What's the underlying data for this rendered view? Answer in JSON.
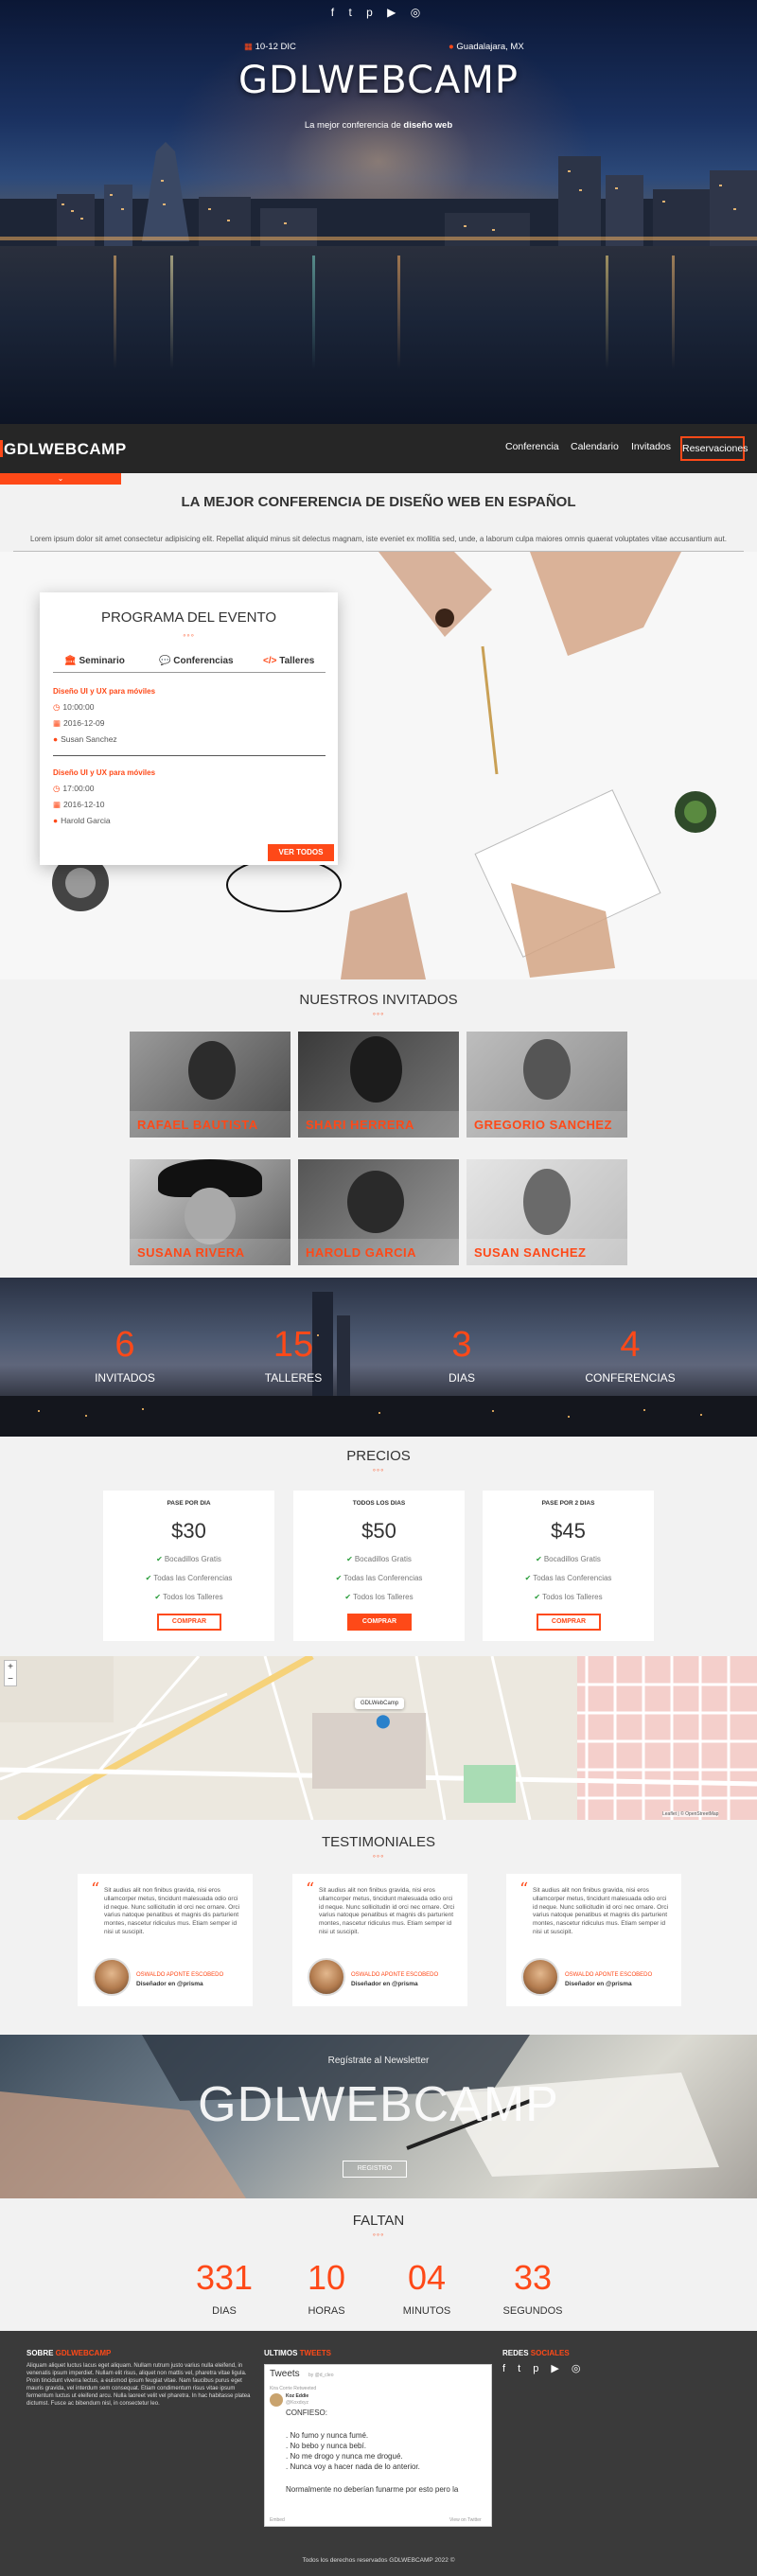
{
  "hero": {
    "social_icons": [
      "facebook-icon",
      "twitter-icon",
      "pinterest-icon",
      "youtube-icon",
      "instagram-icon"
    ],
    "social_glyphs": "f  t  p  ▶  ◎",
    "date_icon": "calendar-icon",
    "date": "10-12 DIC",
    "location_icon": "map-marker-icon",
    "location": "Guadalajara, MX",
    "logo": "GDLWEBCAMP",
    "tagline_pre": "La mejor conferencia de ",
    "tagline_bold": "diseño web"
  },
  "nav": {
    "brand": "GDLWEBCAMP",
    "items": [
      "Conferencia",
      "Calendario",
      "Invitados"
    ],
    "cta": "Reservaciones",
    "chevron": "⌄"
  },
  "intro": {
    "title": "LA MEJOR CONFERENCIA DE DISEÑO WEB EN ESPAÑOL",
    "text": "Lorem ipsum dolor sit amet consectetur adipisicing elit. Repellat aliquid minus sit delectus magnam, iste eveniet ex mollitia sed, unde, a laborum culpa maiores omnis quaerat voluptates vitae accusantium aut."
  },
  "program": {
    "title": "PROGRAMA DEL EVENTO",
    "dots": "◦◦◦",
    "tabs": [
      {
        "icon": "university-icon",
        "glyph": "🏛",
        "label": "Seminario"
      },
      {
        "icon": "comment-icon",
        "glyph": "💬",
        "label": "Conferencias"
      },
      {
        "icon": "code-icon",
        "glyph": "</>",
        "label": "Talleres"
      }
    ],
    "events": [
      {
        "title": "Diseño UI y UX para móviles",
        "time": "10:00:00",
        "date": "2016-12-09",
        "speaker": "Susan Sanchez"
      },
      {
        "title": "Diseño UI y UX para móviles",
        "time": "17:00:00",
        "date": "2016-12-10",
        "speaker": "Harold Garcia"
      }
    ],
    "button": "VER TODOS"
  },
  "guests": {
    "title": "NUESTROS INVITADOS",
    "dots": "◦◦◦",
    "items": [
      "RAFAEL BAUTISTA",
      "SHARI HERRERA",
      "GREGORIO SANCHEZ",
      "SUSANA RIVERA",
      "HAROLD GARCIA",
      "SUSAN SANCHEZ"
    ]
  },
  "stats": [
    {
      "value": "6",
      "label": "INVITADOS"
    },
    {
      "value": "15",
      "label": "TALLERES"
    },
    {
      "value": "3",
      "label": "DIAS"
    },
    {
      "value": "4",
      "label": "CONFERENCIAS"
    }
  ],
  "prices": {
    "title": "PRECIOS",
    "dots": "◦◦◦",
    "plans": [
      {
        "name": "PASE POR DIA",
        "amount": "$30",
        "features": [
          "Bocadillos Gratis",
          "Todas las Conferencias",
          "Todos los Talleres"
        ],
        "button": "COMPRAR"
      },
      {
        "name": "TODOS LOS DIAS",
        "amount": "$50",
        "features": [
          "Bocadillos Gratis",
          "Todas las Conferencias",
          "Todos los Talleres"
        ],
        "button": "COMPRAR"
      },
      {
        "name": "PASE POR 2 DIAS",
        "amount": "$45",
        "features": [
          "Bocadillos Gratis",
          "Todas las Conferencias",
          "Todos los Talleres"
        ],
        "button": "COMPRAR"
      }
    ]
  },
  "map": {
    "marker_label": "GDLWebCamp",
    "zoom_in": "+",
    "zoom_out": "−",
    "attribution": "Leaflet | © OpenStreetMap"
  },
  "testimonials": {
    "title": "TESTIMONIALES",
    "dots": "◦◦◦",
    "text": "Sit audius alit non finibus gravida, nisi eros ullamcorper metus, tincidunt malesuada odio orci id neque. Nunc sollicitudin id orci nec ornare. Orci varius natoque penatibus et magnis dis parturient montes, nascetur ridiculus mus. Etiam semper id nisi ut suscipit.",
    "author": "OSWALDO APONTE ESCOBEDO",
    "role": "Diseñador en @prisma"
  },
  "newsletter": {
    "small": "Regístrate al Newsletter",
    "big": "GDLWEBCAMP",
    "button": "REGISTRO"
  },
  "countdown": {
    "title": "FALTAN",
    "dots": "◦◦◦",
    "items": [
      {
        "value": "331",
        "label": "DIAS"
      },
      {
        "value": "10",
        "label": "HORAS"
      },
      {
        "value": "04",
        "label": "MINUTOS"
      },
      {
        "value": "33",
        "label": "SEGUNDOS"
      }
    ]
  },
  "footer": {
    "about_pre": "SOBRE ",
    "about_accent": "GDLWEBCAMP",
    "about_text": "Aliquam aliquet luctus lacus eget aliquam. Nullam rutrum justo varius nulla eleifend, in venenatis ipsum imperdiet. Nullam elit risus, aliquet non mattis vel, pharetra vitae ligula. Proin tincidunt viverra lectus, a euismod ipsum feugiat vitae. Nam faucibus purus eget mauris gravida, vel interdum sem consequat. Etiam condimentum risus vitae ipsum fermentum luctus ut eleifend arcu. Nulla laoreet velit vel pharetra. In hac habitasse platea dictumst. Fusce ac bibendum nisl, in consectetur leo.",
    "tweets_pre": "ULTIMOS ",
    "tweets_accent": "TWEETS",
    "social_pre": "REDES ",
    "social_accent": "SOCIALES",
    "social_glyphs": "f t p ▶ ◎",
    "copyright": "Todos los derechos reservados GDLWEBCAMP 2022 ©"
  },
  "twitter_widget": {
    "heading": "Tweets",
    "by": "by @d_cleo",
    "retweet": "Kira Corrie Retweeted",
    "user": "Koz Eddie",
    "handle": "@Koxdxyz",
    "lines": [
      "CONFIESO:",
      "",
      ". No fumo y nunca fumé.",
      ". No bebo y nunca bebí.",
      ". No me drogo y nunca me drogué.",
      ". Nunca voy a hacer nada de lo anterior.",
      "",
      "Normalmente no deberían funarme por esto pero la"
    ],
    "embed": "Embed",
    "view": "View on Twitter"
  },
  "colors": {
    "accent": "#fe4918",
    "dark": "#262626",
    "footer": "#3a3a3a"
  }
}
